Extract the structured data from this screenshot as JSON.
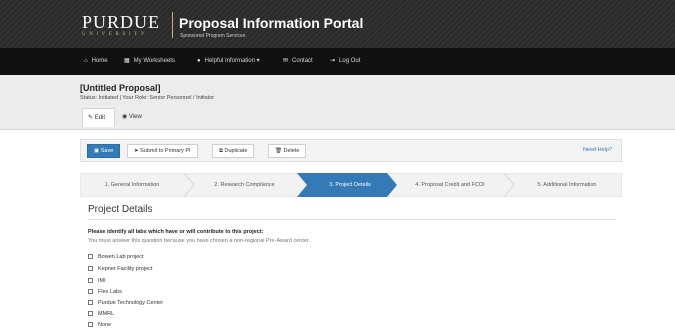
{
  "header": {
    "logo_word": "PURDUE",
    "logo_sub": "UNIVERSITY",
    "title": "Proposal Information Portal",
    "subtitle": "Sponsored Program Services"
  },
  "nav": {
    "home": "Home",
    "worksheets": "My Worksheets",
    "helpful": "Helpful Information",
    "contact": "Contact",
    "logout": "Log Out"
  },
  "proposal": {
    "title": "[Untitled Proposal]",
    "status": "Status: Initiated | Your Role: Senior Personnel / Initiator"
  },
  "tabs": {
    "edit": "Edit",
    "view": "View"
  },
  "toolbar": {
    "save": "Save",
    "submit": "Submit to Primary PI",
    "duplicate": "Duplicate",
    "delete": "Delete",
    "help": "Need Help?"
  },
  "wizard": {
    "active_index": 2,
    "steps": [
      "1. General Information",
      "2. Research Compliance",
      "3. Project Details",
      "4. Proposal Credit and FCOI",
      "5. Additional Information"
    ]
  },
  "section": {
    "title": "Project Details",
    "question": "Please identify all labs which have or will contribute to this project:",
    "note": "You must answer this question because you have chosen a non-regional Pre-Award center."
  },
  "labs": [
    "Bowen Lab project",
    "Kepner Facility project",
    "IMI",
    "Flex Labs",
    "Purdue Technology Center",
    "MMRL",
    "None"
  ],
  "colors": {
    "primary": "#337ab7",
    "gold": "#c9b27a",
    "nav_bg": "#111111"
  }
}
